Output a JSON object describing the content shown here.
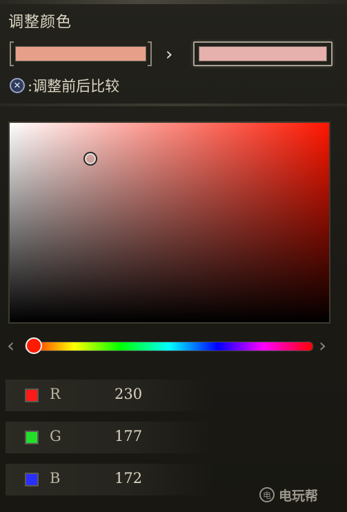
{
  "header": {
    "title": "调整颜色"
  },
  "swatches": {
    "before_color": "#e6a08a",
    "after_color": "#e6b1ac",
    "arrow_icon": "chevron-right-icon"
  },
  "compare": {
    "button_glyph": "✕",
    "label": ":调整前后比较"
  },
  "picker": {
    "hue_color": "#ff1600",
    "knob_color": "#ff1a00"
  },
  "hue_slider": {
    "left_arrow": "‹",
    "right_arrow": "›"
  },
  "channels": [
    {
      "label": "R",
      "value": "230",
      "swatch_color": "#ff1a1a"
    },
    {
      "label": "G",
      "value": "177",
      "swatch_color": "#22e02a"
    },
    {
      "label": "B",
      "value": "172",
      "swatch_color": "#2a2fff"
    }
  ],
  "watermark": {
    "icon": "电",
    "text": "电玩帮"
  }
}
